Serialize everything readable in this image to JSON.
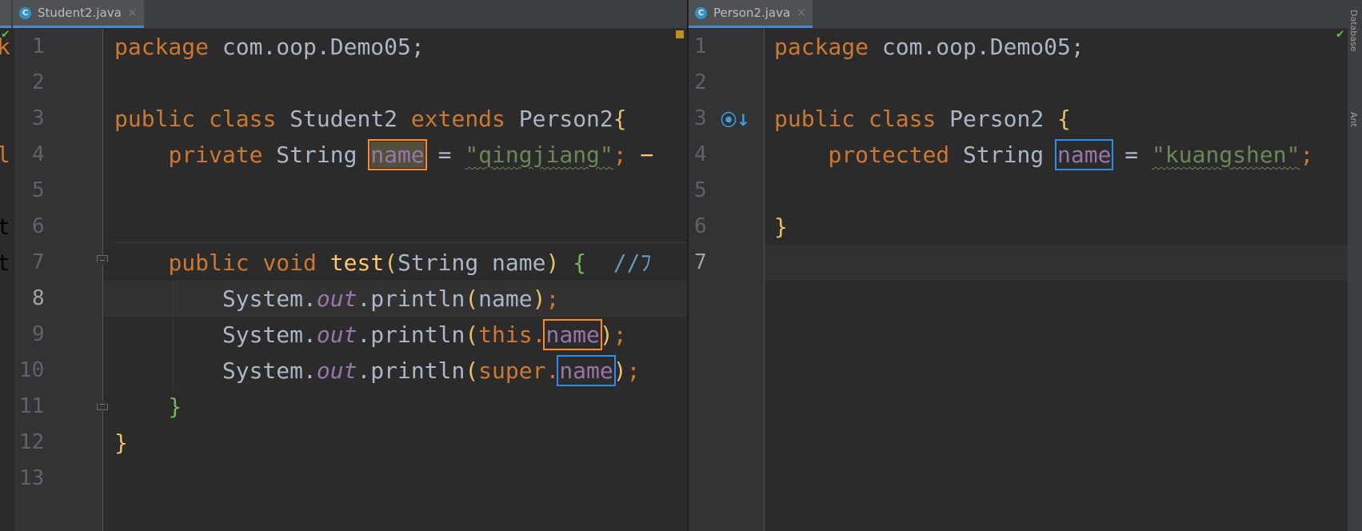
{
  "left_editor": {
    "tab": {
      "title": "Student2.java",
      "icon": "C",
      "close": "×"
    },
    "lines": [
      {
        "n": "1"
      },
      {
        "n": "2"
      },
      {
        "n": "3"
      },
      {
        "n": "4"
      },
      {
        "n": "5"
      },
      {
        "n": "6"
      },
      {
        "n": "7"
      },
      {
        "n": "8"
      },
      {
        "n": "9"
      },
      {
        "n": "10"
      },
      {
        "n": "11"
      },
      {
        "n": "12"
      },
      {
        "n": "13"
      }
    ],
    "code": {
      "l1_kw": "package",
      "l1_rest": " com.oop.Demo05;",
      "l3_kw1": "public",
      "l3_kw2": "class",
      "l3_name": " Student2 ",
      "l3_kw3": "extends",
      "l3_parent": " Person2",
      "l3_brace": "{",
      "l4_kw": "private",
      "l4_type": " String ",
      "l4_field": "name",
      "l4_eq": " = ",
      "l4_str": "\"qingjiang\"",
      "l4_semi": ";",
      "l7_kw1": "public",
      "l7_kw2": "void",
      "l7_fn": "test",
      "l7_paren": "(",
      "l7_params": "String name",
      "l7_close": ")",
      "l7_brace": "{",
      "l7_cmt": "//ﾌ",
      "l8_sys": "System.",
      "l8_out": "out",
      "l8_call": ".println",
      "l8_open": "(",
      "l8_arg": "name",
      "l8_close": ")",
      "l8_semi": ";",
      "l9_sys": "System.",
      "l9_out": "out",
      "l9_call": ".println",
      "l9_open": "(",
      "l9_this": "this.",
      "l9_field": "name",
      "l9_close": ")",
      "l9_semi": ";",
      "l10_sys": "System.",
      "l10_out": "out",
      "l10_call": ".println",
      "l10_open": "(",
      "l10_super": "super.",
      "l10_field": "name",
      "l10_close": ")",
      "l10_semi": ";",
      "l11_brace": "}",
      "l12_brace": "}"
    },
    "edge_fragments": {
      "f1": "k",
      "f4": "l",
      "f6": "t",
      "f7": "t"
    }
  },
  "right_editor": {
    "tab": {
      "title": "Person2.java",
      "icon": "C",
      "close": "×"
    },
    "lines": [
      {
        "n": "1"
      },
      {
        "n": "2"
      },
      {
        "n": "3"
      },
      {
        "n": "4"
      },
      {
        "n": "5"
      },
      {
        "n": "6"
      },
      {
        "n": "7"
      }
    ],
    "code": {
      "l1_kw": "package",
      "l1_rest": " com.oop.Demo05;",
      "l3_kw1": "public",
      "l3_kw2": "class",
      "l3_name": " Person2 ",
      "l3_brace": "{",
      "l4_kw": "protected",
      "l4_type": " String ",
      "l4_field": "name",
      "l4_eq": " = ",
      "l4_str": "\"kuangshen\"",
      "l4_semi": ";",
      "l6_brace": "}"
    }
  },
  "tool_strip": {
    "database": "Database",
    "ant": "Ant"
  },
  "colors": {
    "background": "#2b2b2b",
    "keyword": "#cc7832",
    "string": "#6a8759",
    "field": "#9876aa",
    "method": "#ffc66d",
    "box_orange": "#ff8a2b",
    "box_blue": "#2f8ce8"
  }
}
